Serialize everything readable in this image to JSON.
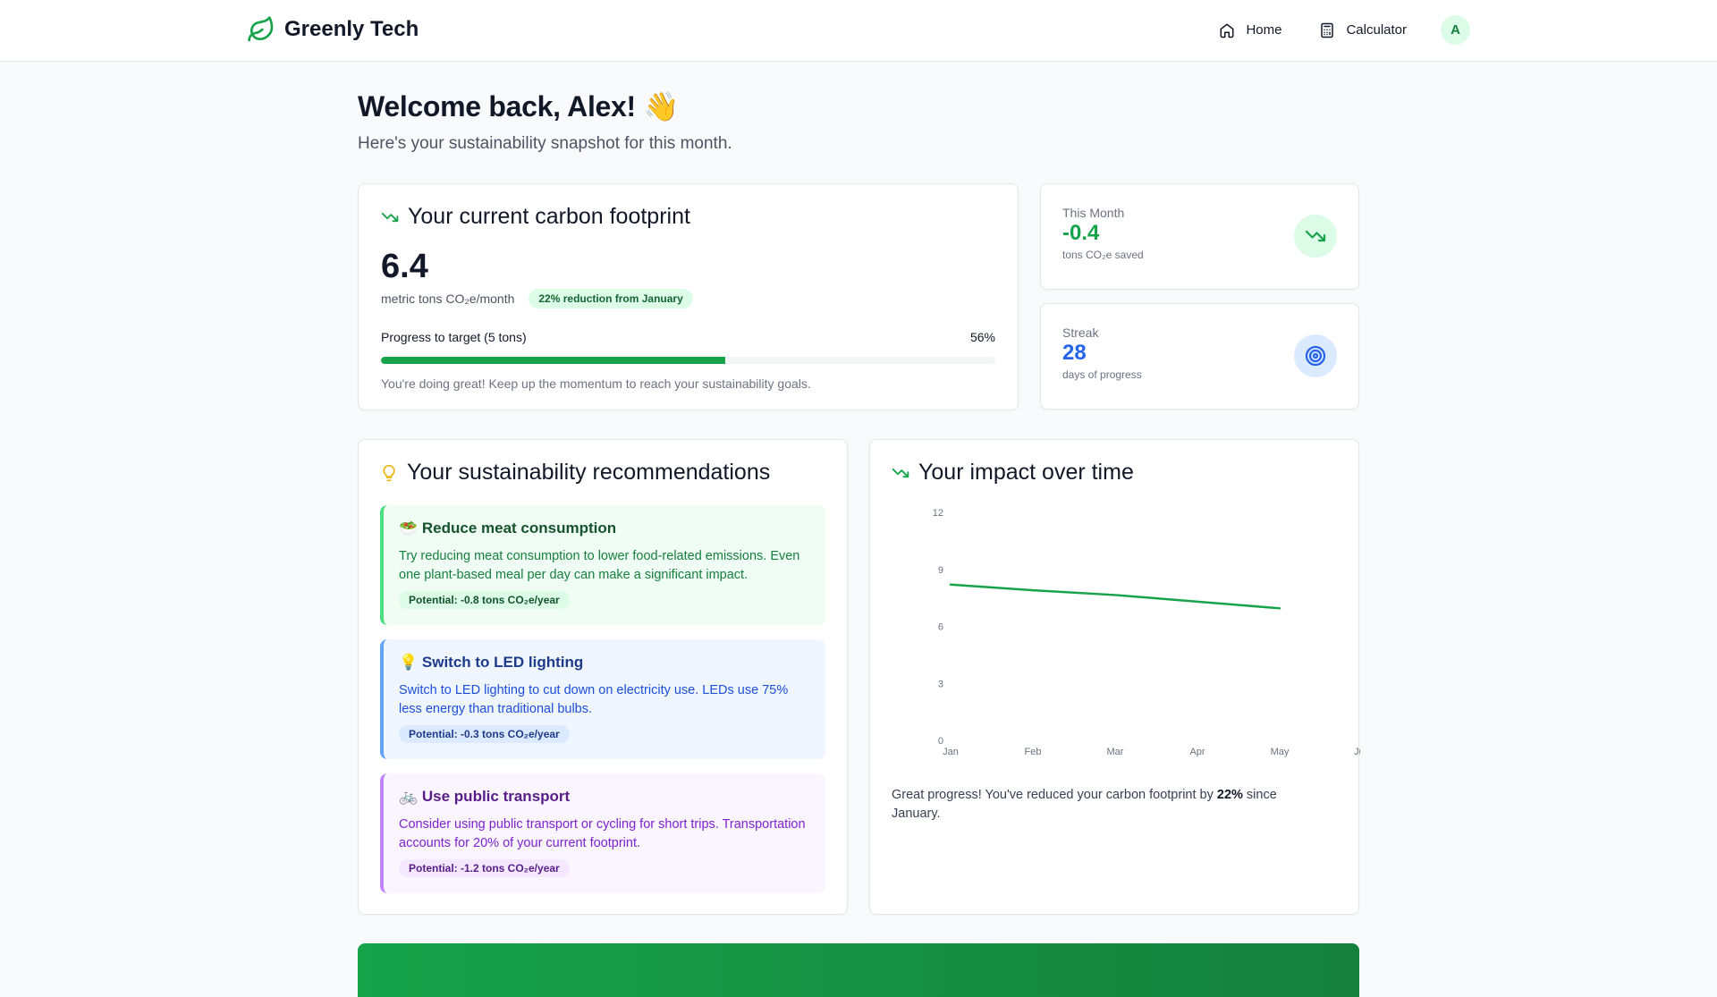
{
  "header": {
    "brand": "Greenly Tech",
    "nav": [
      {
        "label": "Home",
        "icon": "home-icon"
      },
      {
        "label": "Calculator",
        "icon": "calculator-icon"
      }
    ],
    "avatar_initial": "A"
  },
  "welcome": {
    "title": "Welcome back, Alex! 👋",
    "subtitle": "Here's your sustainability snapshot for this month."
  },
  "footprint": {
    "title": "Your current carbon footprint",
    "value": "6.4",
    "unit": "metric tons CO₂e/month",
    "badge": "22% reduction from January",
    "progress_label": "Progress to target (5 tons)",
    "progress_percent_text": "56%",
    "progress_percent": 56,
    "note": "You're doing great! Keep up the momentum to reach your sustainability goals."
  },
  "stats": [
    {
      "label": "This Month",
      "value": "-0.4",
      "sub": "tons CO₂e saved",
      "color": "#16a34a",
      "icon": "trending-down-icon"
    },
    {
      "label": "Streak",
      "value": "28",
      "sub": "days of progress",
      "color": "#2563eb",
      "icon": "target-icon"
    }
  ],
  "recommendations": {
    "title": "Your sustainability recommendations",
    "items": [
      {
        "title": "🥗 Reduce meat consumption",
        "text": "Try reducing meat consumption to lower food-related emissions. Even one plant-based meal per day can make a significant impact.",
        "potential": "Potential: -0.8 tons CO₂e/year"
      },
      {
        "title": "💡 Switch to LED lighting",
        "text": "Switch to LED lighting to cut down on electricity use. LEDs use 75% less energy than traditional bulbs.",
        "potential": "Potential: -0.3 tons CO₂e/year"
      },
      {
        "title": "🚲 Use public transport",
        "text": "Consider using public transport or cycling for short trips. Transportation accounts for 20% of your current footprint.",
        "potential": "Potential: -1.2 tons CO₂e/year"
      }
    ]
  },
  "impact": {
    "title": "Your impact over time",
    "note_prefix": "Great progress! You've reduced your carbon footprint by ",
    "note_bold": "22%",
    "note_suffix": " since January."
  },
  "chart_data": {
    "type": "line",
    "categories": [
      "Jan",
      "Feb",
      "Mar",
      "Apr",
      "May",
      "Jun"
    ],
    "series": [
      {
        "values": [
          8.2,
          7.9,
          7.65,
          7.3,
          6.95,
          null
        ]
      }
    ],
    "ylim": [
      0,
      12
    ],
    "yticks": [
      0,
      3,
      6,
      9,
      12
    ],
    "color": "#16a34a",
    "grid": false
  }
}
